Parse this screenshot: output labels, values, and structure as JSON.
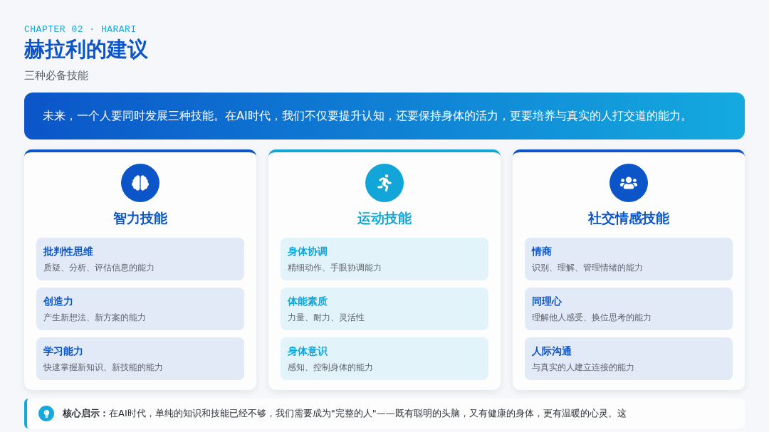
{
  "header": {
    "eyebrow": "CHAPTER 02 · HARARI",
    "title": "赫拉利的建议",
    "subtitle": "三种必备技能"
  },
  "banner": "未来，一个人要同时发展三种技能。在AI时代，我们不仅要提升认知，还要保持身体的活力，更要培养与真实的人打交道的能力。",
  "cards": [
    {
      "title": "智力技能",
      "color": "#0b55c9",
      "items": [
        {
          "title": "批判性思维",
          "desc": "质疑、分析、评估信息的能力"
        },
        {
          "title": "创造力",
          "desc": "产生新想法、新方案的能力"
        },
        {
          "title": "学习能力",
          "desc": "快速掌握新知识、新技能的能力"
        }
      ]
    },
    {
      "title": "运动技能",
      "color": "#12a5d8",
      "items": [
        {
          "title": "身体协调",
          "desc": "精细动作、手眼协调能力"
        },
        {
          "title": "体能素质",
          "desc": "力量、耐力、灵活性"
        },
        {
          "title": "身体意识",
          "desc": "感知、控制身体的能力"
        }
      ]
    },
    {
      "title": "社交情感技能",
      "color": "#0b55c9",
      "items": [
        {
          "title": "情商",
          "desc": "识别、理解、管理情绪的能力"
        },
        {
          "title": "同理心",
          "desc": "理解他人感受、换位思考的能力"
        },
        {
          "title": "人际沟通",
          "desc": "与真实的人建立连接的能力"
        }
      ]
    }
  ],
  "insight": "**核心启示：**在AI时代，单纯的知识和技能已经不够，我们需要成为\"完整的人\"——既有聪明的头脑，又有健康的身体，更有温暖的心灵。这"
}
